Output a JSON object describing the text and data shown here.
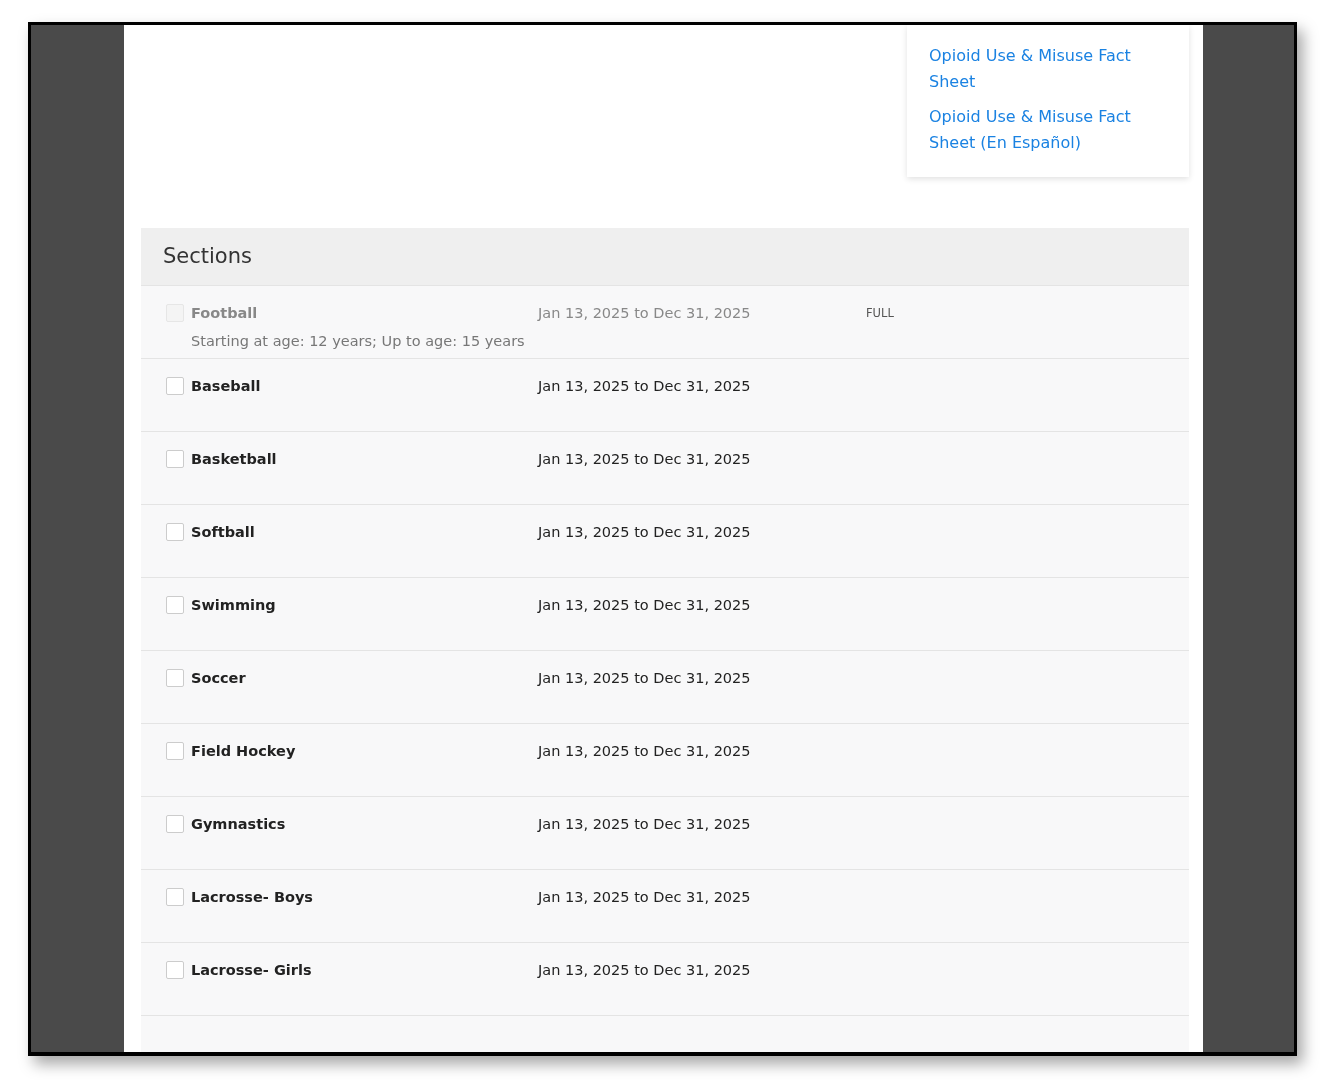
{
  "resources": {
    "links": [
      "Opioid Use & Misuse Fact Sheet",
      "Opioid Use & Misuse Fact Sheet (En Español)"
    ]
  },
  "sections": {
    "title": "Sections",
    "rows": [
      {
        "name": "Football",
        "dates": "Jan 13, 2025 to Dec 31, 2025",
        "note": "Starting at age: 12 years; Up to age: 15 years",
        "status": "FULL",
        "disabled": true,
        "checked": false
      },
      {
        "name": "Baseball",
        "dates": "Jan 13, 2025 to Dec 31, 2025",
        "disabled": false,
        "checked": false
      },
      {
        "name": "Basketball",
        "dates": "Jan 13, 2025 to Dec 31, 2025",
        "disabled": false,
        "checked": false
      },
      {
        "name": "Softball",
        "dates": "Jan 13, 2025 to Dec 31, 2025",
        "disabled": false,
        "checked": false
      },
      {
        "name": "Swimming",
        "dates": "Jan 13, 2025 to Dec 31, 2025",
        "disabled": false,
        "checked": false
      },
      {
        "name": "Soccer",
        "dates": "Jan 13, 2025 to Dec 31, 2025",
        "disabled": false,
        "checked": false
      },
      {
        "name": "Field Hockey",
        "dates": "Jan 13, 2025 to Dec 31, 2025",
        "disabled": false,
        "checked": false
      },
      {
        "name": "Gymnastics",
        "dates": "Jan 13, 2025 to Dec 31, 2025",
        "disabled": false,
        "checked": false
      },
      {
        "name": "Lacrosse- Boys",
        "dates": "Jan 13, 2025 to Dec 31, 2025",
        "disabled": false,
        "checked": false
      },
      {
        "name": "Lacrosse- Girls",
        "dates": "Jan 13, 2025 to Dec 31, 2025",
        "disabled": false,
        "checked": false
      }
    ]
  }
}
